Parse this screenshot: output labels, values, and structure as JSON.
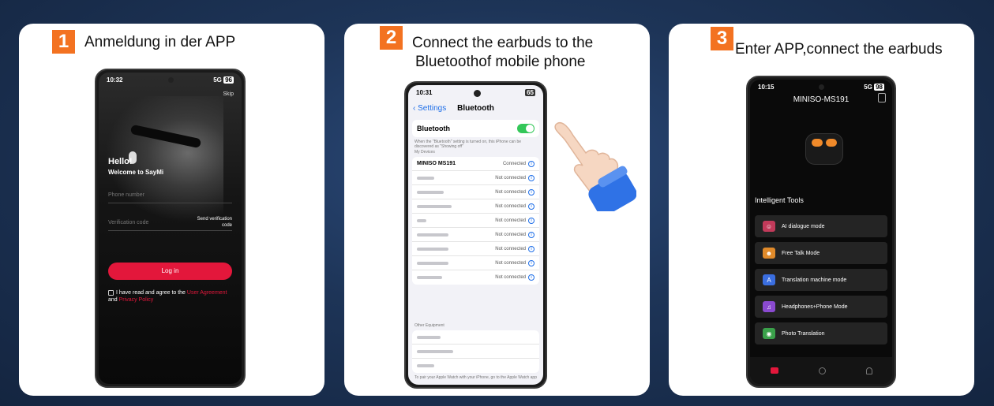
{
  "steps": [
    {
      "num": "1",
      "title": "Anmeldung in der APP"
    },
    {
      "num": "2",
      "title_line1": "Connect the earbuds to the",
      "title_line2": "Bluetoothof mobile phone"
    },
    {
      "num": "3",
      "title": "Enter APP,connect the earbuds"
    }
  ],
  "phone1": {
    "time": "10:32",
    "signal": "5G",
    "battery": "96",
    "skip": "Skip",
    "hello": "Hello!",
    "welcome": "Welcome to SayMi",
    "phone_placeholder": "Phone number",
    "code_placeholder": "Verification code",
    "send_code": "Send verification code",
    "login": "Log in",
    "agree_text": "I have read and agree to the",
    "user_agreement": "User Agreement",
    "and": "and",
    "privacy": "Privacy Policy"
  },
  "phone2": {
    "time": "10:31",
    "battery": "65",
    "back": "Settings",
    "title": "Bluetooth",
    "bt_label": "Bluetooth",
    "note": "When the \"Bluetooth\" setting is turned on, this iPhone can be discovered as \"Showing off\"",
    "my_devices": "My Devices",
    "first_device": {
      "name": "MINISO MS191",
      "status": "Connected"
    },
    "not_connected": "Not connected",
    "other_header": "Other Equipment",
    "footer": "To pair your Apple Watch with your iPhone, go to the Apple Watch app"
  },
  "phone3": {
    "time": "10:15",
    "signal": "5G",
    "battery": "98",
    "device": "MINISO-MS191",
    "section": "Intelligent Tools",
    "tools": [
      {
        "label": "AI dialogue mode",
        "color": "#c23a5a"
      },
      {
        "label": "Free Talk Mode",
        "color": "#e08a2a"
      },
      {
        "label": "Translation machine mode",
        "color": "#3a6ee0"
      },
      {
        "label": "Headphones+Phone Mode",
        "color": "#8a4ad0"
      },
      {
        "label": "Photo Translation",
        "color": "#3aa04a"
      }
    ]
  }
}
